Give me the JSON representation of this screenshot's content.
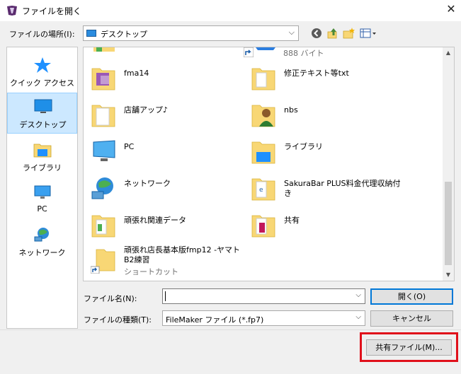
{
  "window": {
    "title": "ファイルを開く",
    "close_glyph": "✕"
  },
  "location": {
    "label": "ファイルの場所(I):",
    "value": "デスクトップ",
    "arrow": "⌵"
  },
  "toolbar": {
    "back": "◀",
    "up": "⬆",
    "new_folder": "📁",
    "view": "▦"
  },
  "places": [
    {
      "id": "quick-access",
      "label": "クイック アクセス",
      "icon": "star-icon"
    },
    {
      "id": "desktop",
      "label": "デスクトップ",
      "icon": "desktop-icon",
      "selected": true
    },
    {
      "id": "library",
      "label": "ライブラリ",
      "icon": "library-icon"
    },
    {
      "id": "pc",
      "label": "PC",
      "icon": "pc-icon"
    },
    {
      "id": "network",
      "label": "ネットワーク",
      "icon": "network-icon"
    }
  ],
  "files": {
    "partial_top_right_sub": "888 バイト",
    "left": [
      {
        "name": "fma14",
        "icon": "folder-icon"
      },
      {
        "name": "店舗アップ♪",
        "icon": "document-icon"
      },
      {
        "name": "PC",
        "icon": "pc-icon"
      },
      {
        "name": "ネットワーク",
        "icon": "network-icon"
      },
      {
        "name": "頑張れ関連データ",
        "icon": "folder-icon"
      },
      {
        "name": "頑張れ店長基本版fmp12 -ヤマトB2練習",
        "sub": "ショートカット",
        "icon": "shortcut-folder-icon"
      }
    ],
    "right": [
      {
        "name": "修正テキスト等txt",
        "icon": "folder-icon"
      },
      {
        "name": "nbs",
        "icon": "user-folder-icon"
      },
      {
        "name": "ライブラリ",
        "icon": "library-icon"
      },
      {
        "name": "SakuraBar PLUS料金代理収納付き",
        "icon": "folder-icon"
      },
      {
        "name": "共有",
        "icon": "folder-icon"
      }
    ]
  },
  "bottom": {
    "filename_label": "ファイル名(N):",
    "filename_value": "",
    "filetype_label": "ファイルの種類(T):",
    "filetype_value": "FileMaker ファイル (*.fp7)",
    "open_button": "開く(O)",
    "cancel_button": "キャンセル",
    "shared_button": "共有ファイル(M)..."
  },
  "colors": {
    "accent": "#0078d7",
    "selection": "#cce8ff",
    "highlight_border": "#e0101b",
    "folder": "#f8d775"
  }
}
